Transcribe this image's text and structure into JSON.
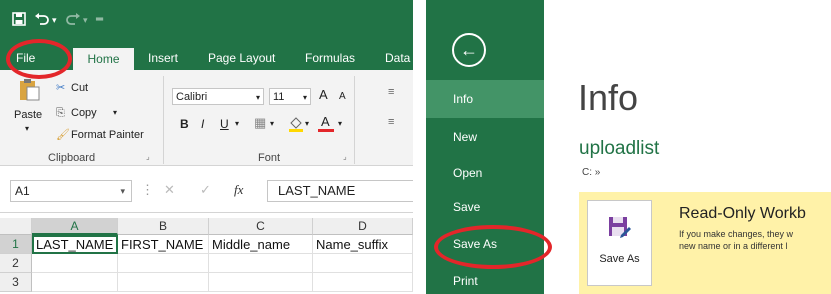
{
  "excel": {
    "quick_access": {
      "save_icon": "save-icon",
      "undo_icon": "undo-icon",
      "redo_icon": "redo-icon",
      "customize_icon": "customize-icon"
    },
    "tabs": [
      {
        "label": "File"
      },
      {
        "label": "Home"
      },
      {
        "label": "Insert"
      },
      {
        "label": "Page Layout"
      },
      {
        "label": "Formulas"
      },
      {
        "label": "Data"
      }
    ],
    "clipboard": {
      "paste_label": "Paste",
      "cut_label": "Cut",
      "copy_label": "Copy",
      "format_painter_label": "Format Painter",
      "group_label": "Clipboard"
    },
    "font": {
      "name": "Calibri",
      "size": "11",
      "grow_label": "A",
      "shrink_label": "A",
      "bold_label": "B",
      "italic_label": "I",
      "underline_label": "U",
      "font_color_label": "A",
      "group_label": "Font"
    },
    "formula_bar": {
      "name_box": "A1",
      "cancel_label": "✕",
      "enter_label": "✓",
      "fx_label": "fx",
      "value": "LAST_NAME"
    },
    "sheet": {
      "columns": [
        "A",
        "B",
        "C",
        "D"
      ],
      "rows": [
        {
          "num": "1",
          "cells": [
            "LAST_NAME",
            "FIRST_NAME",
            "Middle_name",
            "Name_suffix"
          ]
        },
        {
          "num": "2",
          "cells": [
            "",
            "",
            "",
            ""
          ]
        },
        {
          "num": "3",
          "cells": [
            "",
            "",
            "",
            ""
          ]
        }
      ]
    },
    "colors": {
      "accent": "#217346",
      "annotation": "#e3262a"
    }
  },
  "backstage": {
    "back_icon": "back-arrow-icon",
    "menu": [
      {
        "label": "Info",
        "selected": true
      },
      {
        "label": "New"
      },
      {
        "label": "Open"
      },
      {
        "label": "Save"
      },
      {
        "label": "Save As"
      },
      {
        "label": "Print"
      }
    ],
    "title": "Info",
    "file_name": "uploadlist",
    "path": "C: »",
    "read_only": {
      "button_label": "Save As",
      "title": "Read-Only Workb",
      "message_line1": "If you make changes, they w",
      "message_line2": "new name or in a different l"
    },
    "colors": {
      "sidebar": "#217346",
      "selected": "#439467",
      "warning_bg": "#fff2a8"
    }
  }
}
